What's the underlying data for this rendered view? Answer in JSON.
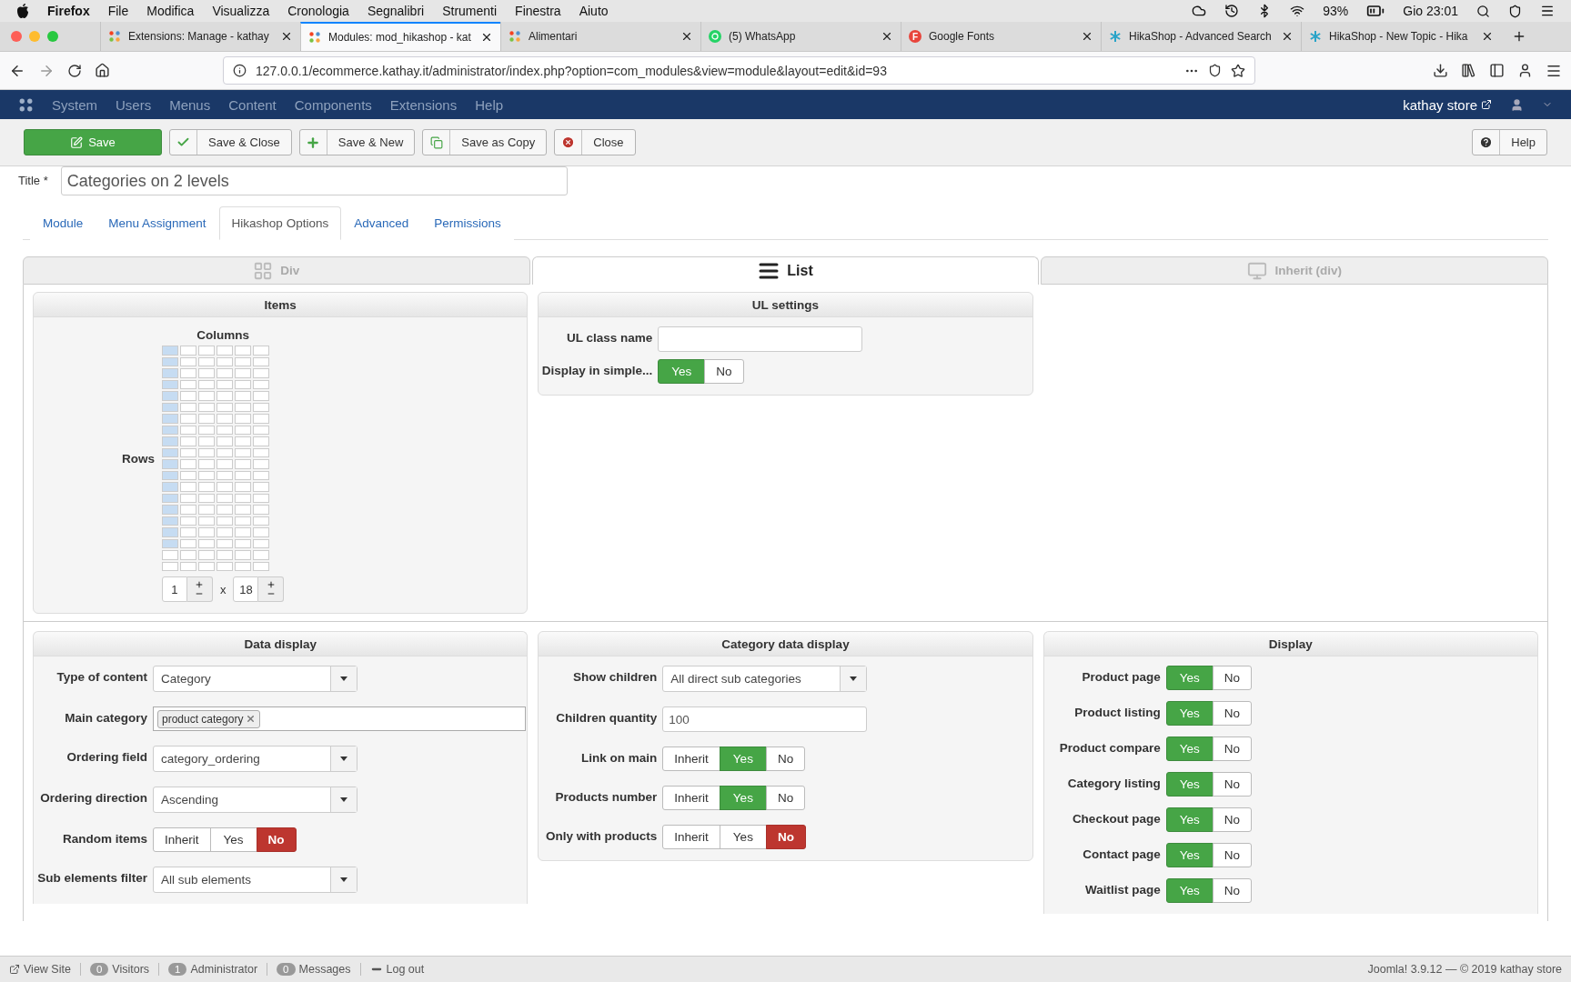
{
  "menubar": {
    "app": "Firefox",
    "items": [
      "File",
      "Modifica",
      "Visualizza",
      "Cronologia",
      "Segnalibri",
      "Strumenti",
      "Finestra",
      "Aiuto"
    ],
    "battery": "93%",
    "clock": "Gio 23:01"
  },
  "browser_tabs": [
    {
      "title": "Extensions: Manage - kathay",
      "kind": "joomla",
      "selected": false
    },
    {
      "title": "Modules: mod_hikashop - kat",
      "kind": "joomla",
      "selected": true
    },
    {
      "title": "Alimentari",
      "kind": "joomla",
      "selected": false
    },
    {
      "title": "(5) WhatsApp",
      "kind": "chat",
      "selected": false
    },
    {
      "title": "Google Fonts",
      "kind": "letter",
      "letter": "F",
      "selected": false
    },
    {
      "title": "HikaShop - Advanced Search",
      "kind": "star",
      "selected": false
    },
    {
      "title": "HikaShop - New Topic - Hika",
      "kind": "star",
      "selected": false
    }
  ],
  "address": {
    "url": "127.0.0.1/ecommerce.kathay.it/administrator/index.php?option=com_modules&view=module&layout=edit&id=93"
  },
  "admin_nav": {
    "items": [
      "System",
      "Users",
      "Menus",
      "Content",
      "Components",
      "Extensions",
      "Help"
    ],
    "site": "kathay store"
  },
  "toolbar": {
    "buttons": [
      {
        "label": "Save",
        "kind": "save"
      },
      {
        "label": "Save & Close",
        "kind": "check"
      },
      {
        "label": "Save & New",
        "kind": "new"
      },
      {
        "label": "Save as Copy",
        "kind": "copy"
      },
      {
        "label": "Close",
        "kind": "close"
      }
    ],
    "help": "Help"
  },
  "title_field": {
    "label": "Title *",
    "value": "Categories on 2 levels"
  },
  "tabs": [
    {
      "label": "Module",
      "selected": false
    },
    {
      "label": "Menu Assignment",
      "selected": false
    },
    {
      "label": "Hikashop Options",
      "selected": true
    },
    {
      "label": "Advanced",
      "selected": false
    },
    {
      "label": "Permissions",
      "selected": false
    }
  ],
  "layout_tabs": [
    {
      "label": "Div",
      "kind": "grid",
      "selected": false
    },
    {
      "label": "List",
      "kind": "list",
      "selected": true
    },
    {
      "label": "Inherit (div)",
      "kind": "inherit",
      "selected": false
    }
  ],
  "items_panel": {
    "title": "Items",
    "columns_label": "Columns",
    "rows_label": "Rows",
    "columns_value": "1",
    "separator": "x",
    "rows_value": "18"
  },
  "ul_panel": {
    "title": "UL settings",
    "fields": [
      {
        "label": "UL class name",
        "kind": "text"
      },
      {
        "label": "Display in simple...",
        "kind": "toggle",
        "options": [
          {
            "label": "Yes",
            "kind": "yes",
            "selected": true
          },
          {
            "label": "No",
            "kind": "no",
            "selected": false
          }
        ]
      }
    ]
  },
  "panels": [
    {
      "title": "Data display",
      "fields": [
        {
          "label": "Type of content",
          "kind": "select",
          "value": "Category"
        },
        {
          "label": "Main category",
          "kind": "tags",
          "tags": [
            "product category"
          ]
        },
        {
          "label": "Ordering field",
          "kind": "select",
          "value": "category_ordering"
        },
        {
          "label": "Ordering direction",
          "kind": "select",
          "value": "Ascending"
        },
        {
          "label": "Random items",
          "kind": "toggle",
          "options": [
            {
              "label": "Inherit",
              "kind": "inherit",
              "selected": false
            },
            {
              "label": "Yes",
              "kind": "yes",
              "selected": false
            },
            {
              "label": "No",
              "kind": "no",
              "selected": true
            }
          ]
        },
        {
          "label": "Sub elements filter",
          "kind": "select",
          "value": "All sub elements"
        }
      ]
    },
    {
      "title": "Category data display",
      "fields": [
        {
          "label": "Show children",
          "kind": "select",
          "value": "All direct sub categories"
        },
        {
          "label": "Children quantity",
          "kind": "text",
          "value": "100"
        },
        {
          "label": "Link on main",
          "kind": "toggle",
          "options": [
            {
              "label": "Inherit",
              "kind": "inherit",
              "selected": false
            },
            {
              "label": "Yes",
              "kind": "yes",
              "selected": true
            },
            {
              "label": "No",
              "kind": "no",
              "selected": false
            }
          ]
        },
        {
          "label": "Products number",
          "kind": "toggle",
          "options": [
            {
              "label": "Inherit",
              "kind": "inherit",
              "selected": false
            },
            {
              "label": "Yes",
              "kind": "yes",
              "selected": true
            },
            {
              "label": "No",
              "kind": "no",
              "selected": false
            }
          ]
        },
        {
          "label": "Only with products",
          "kind": "toggle",
          "options": [
            {
              "label": "Inherit",
              "kind": "inherit",
              "selected": false
            },
            {
              "label": "Yes",
              "kind": "yes",
              "selected": false
            },
            {
              "label": "No",
              "kind": "no",
              "selected": true
            }
          ]
        }
      ]
    },
    {
      "title": "Display",
      "fields": [
        {
          "label": "Product page",
          "kind": "toggle",
          "options": [
            {
              "label": "Yes",
              "kind": "yes",
              "selected": true
            },
            {
              "label": "No",
              "kind": "no",
              "selected": false
            }
          ]
        },
        {
          "label": "Product listing",
          "kind": "toggle",
          "options": [
            {
              "label": "Yes",
              "kind": "yes",
              "selected": true
            },
            {
              "label": "No",
              "kind": "no",
              "selected": false
            }
          ]
        },
        {
          "label": "Product compare",
          "kind": "toggle",
          "options": [
            {
              "label": "Yes",
              "kind": "yes",
              "selected": true
            },
            {
              "label": "No",
              "kind": "no",
              "selected": false
            }
          ]
        },
        {
          "label": "Category listing",
          "kind": "toggle",
          "options": [
            {
              "label": "Yes",
              "kind": "yes",
              "selected": true
            },
            {
              "label": "No",
              "kind": "no",
              "selected": false
            }
          ]
        },
        {
          "label": "Checkout page",
          "kind": "toggle",
          "options": [
            {
              "label": "Yes",
              "kind": "yes",
              "selected": true
            },
            {
              "label": "No",
              "kind": "no",
              "selected": false
            }
          ]
        },
        {
          "label": "Contact page",
          "kind": "toggle",
          "options": [
            {
              "label": "Yes",
              "kind": "yes",
              "selected": true
            },
            {
              "label": "No",
              "kind": "no",
              "selected": false
            }
          ]
        },
        {
          "label": "Waitlist page",
          "kind": "toggle",
          "options": [
            {
              "label": "Yes",
              "kind": "yes",
              "selected": true
            },
            {
              "label": "No",
              "kind": "no",
              "selected": false
            }
          ]
        }
      ]
    }
  ],
  "status_bar": {
    "items": [
      {
        "label": "View Site",
        "kind": "link"
      },
      {
        "label": "Visitors",
        "count": "0",
        "kind": "count"
      },
      {
        "label": "Administrator",
        "count": "1",
        "kind": "count"
      },
      {
        "label": "Messages",
        "count": "0",
        "kind": "count"
      },
      {
        "label": "Log out",
        "kind": "logout"
      }
    ],
    "version": "Joomla! 3.9.12  —  © 2019 kathay store"
  }
}
